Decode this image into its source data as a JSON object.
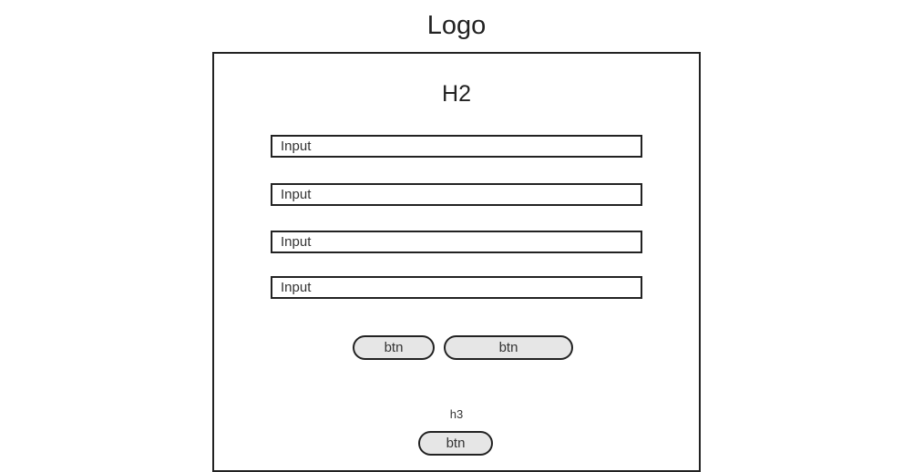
{
  "header": {
    "logo_text": "Logo"
  },
  "form": {
    "title": "H2",
    "inputs": [
      {
        "placeholder": "Input",
        "value": ""
      },
      {
        "placeholder": "Input",
        "value": ""
      },
      {
        "placeholder": "Input",
        "value": ""
      },
      {
        "placeholder": "Input",
        "value": ""
      }
    ],
    "buttons": {
      "primary_label": "btn",
      "secondary_label": "btn"
    },
    "footer": {
      "heading": "h3",
      "button_label": "btn"
    }
  },
  "colors": {
    "border": "#222222",
    "button_fill": "#e6e6e6",
    "background": "#ffffff"
  }
}
